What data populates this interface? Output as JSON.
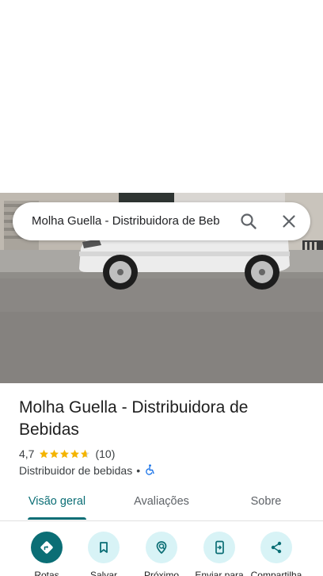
{
  "search": {
    "query": "Molha Guella - Distribuidora de Beb"
  },
  "place": {
    "title": "Molha Guella - Distribuidora de Bebidas",
    "rating": "4,7",
    "stars": 4.7,
    "review_count": "(10)",
    "category": "Distribuidor de bebidas",
    "separator": "•",
    "accessibility_icon": "wheelchair-icon"
  },
  "tabs": [
    {
      "label": "Visão geral",
      "active": true
    },
    {
      "label": "Avaliações",
      "active": false
    },
    {
      "label": "Sobre",
      "active": false
    }
  ],
  "actions": [
    {
      "label": "Rotas",
      "icon": "directions-icon"
    },
    {
      "label": "Salvar",
      "icon": "bookmark-icon"
    },
    {
      "label": "Próximo",
      "icon": "nearby-icon"
    },
    {
      "label": "Enviar para",
      "icon": "send-to-phone-icon"
    },
    {
      "label": "Compartilha",
      "icon": "share-icon"
    }
  ],
  "colors": {
    "accent": "#0b6e75",
    "action_bg": "#d8f3f6",
    "star": "#f4b400"
  }
}
